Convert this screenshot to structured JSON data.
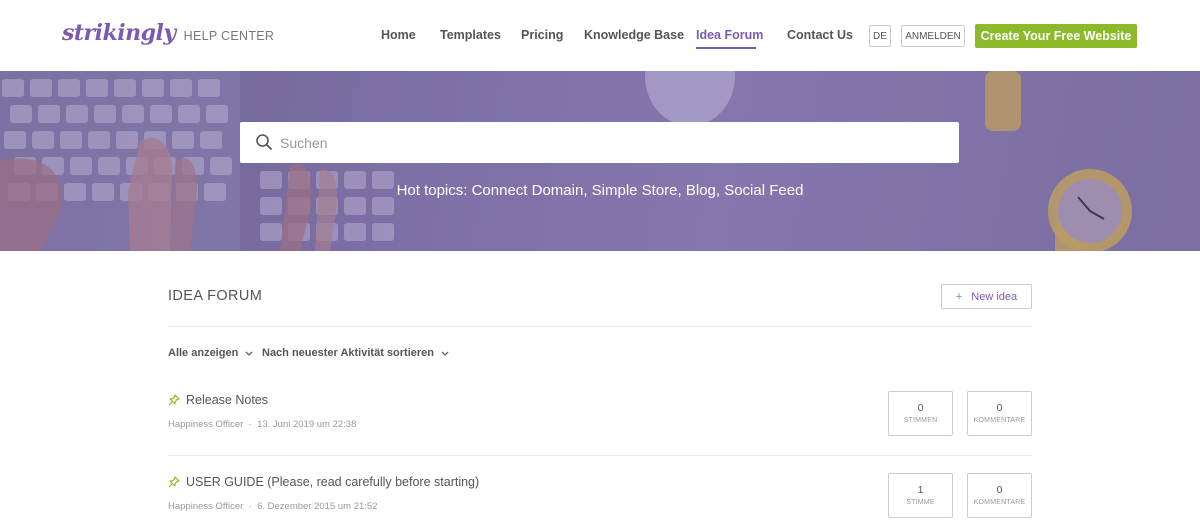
{
  "header": {
    "logo_word": "strikingly",
    "logo_sub": "HELP CENTER",
    "nav": [
      "Home",
      "Templates",
      "Pricing",
      "Knowledge Base",
      "Idea Forum",
      "Contact Us"
    ],
    "active_nav": "Idea Forum",
    "language": "DE",
    "login": "ANMELDEN",
    "cta": "Create Your Free Website"
  },
  "hero": {
    "search_placeholder": "Suchen",
    "hot_topics": "Hot topics: Connect Domain, Simple Store, Blog, Social Feed"
  },
  "forum": {
    "title": "IDEA FORUM",
    "new_idea_plus": "+",
    "new_idea_label": "New idea",
    "filter_show": "Alle anzeigen",
    "filter_sort": "Nach neuester Aktivität sortieren",
    "posts": [
      {
        "title": "Release Notes",
        "author": "Happiness Officer",
        "date": "13. Juni 2019 um 22:38",
        "votes": "0",
        "votes_label": "STIMMEN",
        "comments": "0",
        "comments_label": "KOMMENTARE"
      },
      {
        "title": "USER GUIDE (Please, read carefully before starting)",
        "author": "Happiness Officer",
        "date": "6. Dezember 2015 um 21:52",
        "votes": "1",
        "votes_label": "STIMME",
        "comments": "0",
        "comments_label": "KOMMENTARE"
      }
    ]
  },
  "colors": {
    "brand": "#7c5ab1",
    "cta": "#8cba2a",
    "hero": "#7d70a6",
    "pin": "#8cba2a"
  },
  "icons": [
    "search-icon",
    "chevron-down-icon",
    "pin-icon"
  ]
}
